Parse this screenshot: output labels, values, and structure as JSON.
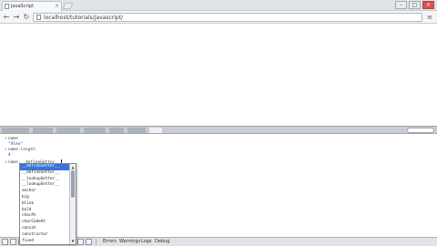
{
  "browser": {
    "tab_title": "JavaScript",
    "tab_close": "×",
    "url": "localhost/tutorials/javascript/",
    "win_minimize": "–",
    "win_maximize": "□",
    "win_close": "×",
    "back": "←",
    "forward": "→",
    "reload": "↻",
    "menu": "≡"
  },
  "console": {
    "lines": [
      {
        "prefix": ">",
        "text": "name"
      },
      {
        "prefix": "",
        "text": "\"Alex\""
      },
      {
        "prefix": ">",
        "text": "name.length"
      },
      {
        "prefix": "",
        "text": "4"
      },
      {
        "prefix": ">",
        "text": "name.__defineGetter__"
      }
    ]
  },
  "autocomplete": {
    "items": [
      "__defineGetter__",
      "__defineSetter__",
      "__lookupGetter__",
      "__lookupSetter__",
      "anchor",
      "big",
      "blink",
      "bold",
      "charAt",
      "charCodeAt",
      "concat",
      "constructor",
      "fixed"
    ],
    "selected_index": 0,
    "scroll_up": "▲",
    "scroll_down": "▼"
  },
  "statusbar": {
    "errors": "Errors",
    "warnings": "Warnings",
    "logs": "Logs",
    "debug": "Debug"
  }
}
